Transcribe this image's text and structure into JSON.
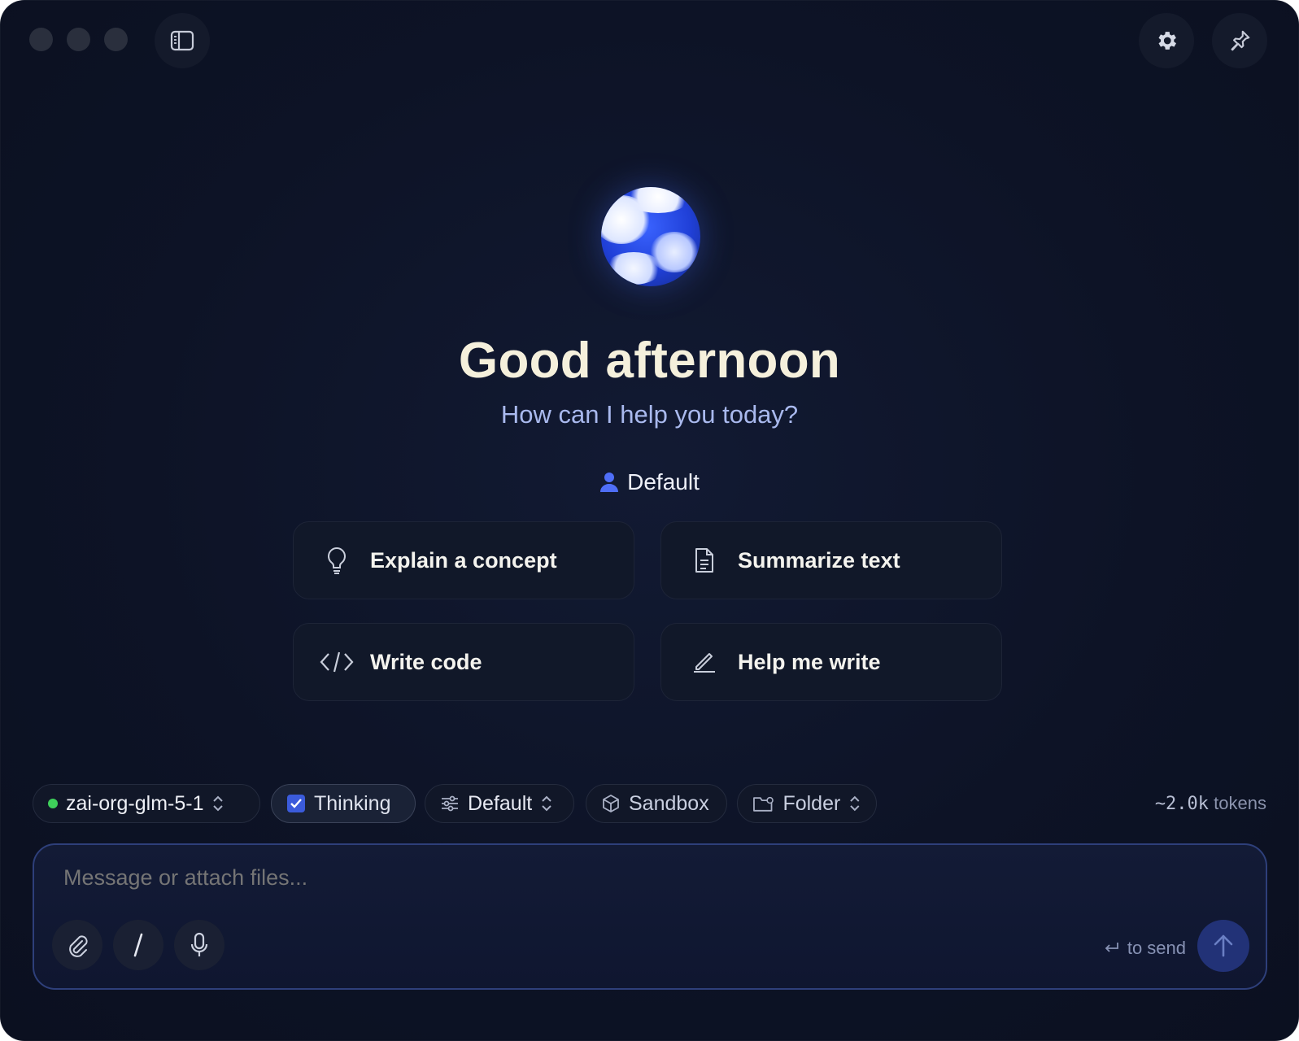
{
  "window": {
    "greeting": "Good afternoon",
    "subtitle": "How can I help you today?",
    "persona": "Default"
  },
  "suggestions": [
    {
      "label": "Explain a concept",
      "icon": "lightbulb-icon"
    },
    {
      "label": "Summarize text",
      "icon": "document-icon"
    },
    {
      "label": "Write code",
      "icon": "code-icon"
    },
    {
      "label": "Help me write",
      "icon": "pen-icon"
    }
  ],
  "toolbar": {
    "model": "zai-org-glm-5-1",
    "model_status_color": "#3ecf5a",
    "thinking": "Thinking",
    "thinking_checked": true,
    "preset": "Default",
    "sandbox": "Sandbox",
    "folder": "Folder",
    "tokens_value": "~2.0k",
    "tokens_label": "tokens"
  },
  "composer": {
    "placeholder": "Message or attach files...",
    "send_hint": "to send"
  },
  "colors": {
    "accent": "#3b5bdb",
    "title": "#f5f0dc",
    "subtitle": "#a9b9ee"
  }
}
